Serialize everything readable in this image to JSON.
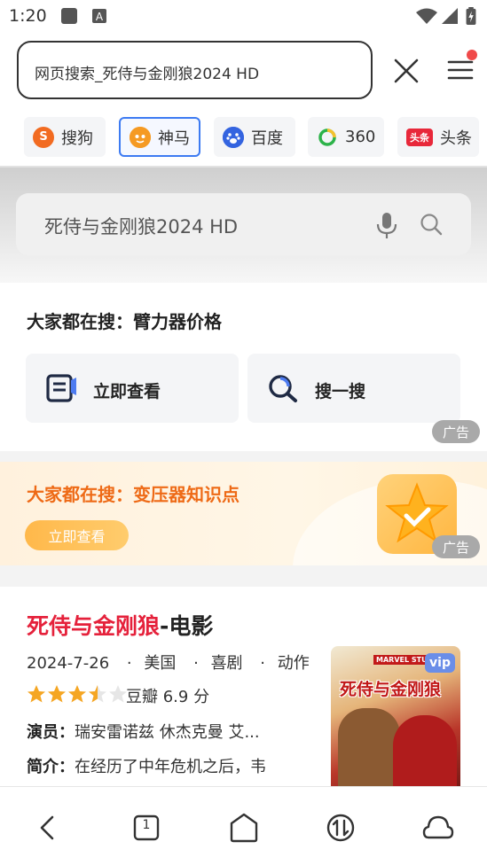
{
  "status_bar": {
    "time": "1:20",
    "icons": [
      "square-app-icon",
      "a-keyboard-icon",
      "wifi-icon",
      "signal-icon",
      "battery-icon"
    ]
  },
  "address_bar": {
    "text": "网页搜索_死侍与金刚狼2024 HD",
    "close_icon": "close-icon",
    "menu_icon": "menu-icon",
    "menu_has_notification": true
  },
  "engines": [
    {
      "label": "搜狗",
      "icon": "sogou-logo",
      "active": false,
      "color": "#f26b21"
    },
    {
      "label": "神马",
      "icon": "shenma-logo",
      "active": true,
      "color": "#f59a23"
    },
    {
      "label": "百度",
      "icon": "baidu-logo",
      "active": false,
      "color": "#3464e0"
    },
    {
      "label": "360",
      "icon": "360-logo",
      "active": false,
      "color": "#2db34a"
    },
    {
      "label": "头条",
      "icon": "toutiao-logo",
      "active": false,
      "color": "#e8283a"
    }
  ],
  "search": {
    "query": "死侍与金刚狼2024 HD",
    "mic_icon": "microphone-icon",
    "search_icon": "search-icon"
  },
  "hot_search": {
    "title": "大家都在搜：臂力器价格",
    "buttons": [
      {
        "label": "立即查看",
        "icon": "document-icon"
      },
      {
        "label": "搜一搜",
        "icon": "magnifier-icon"
      }
    ],
    "ad_label": "广告"
  },
  "banner_ad": {
    "title": "大家都在搜：变压器知识点",
    "button": "立即查看",
    "ad_label": "广告",
    "accent": "#ee6a16"
  },
  "movie": {
    "title_highlight": "死侍与金刚狼",
    "title_rest": "-电影",
    "date": "2024-7-26",
    "region": "美国",
    "genre1": "喜剧",
    "genre2": "动作",
    "sep": "·",
    "stars": 3.5,
    "rating": "豆瓣 6.9 分",
    "cast_key": "演员：",
    "cast_value": "瑞安雷诺兹 休杰克曼 艾...",
    "intro_key": "简介：",
    "intro_value": "在经历了中年危机之后，韦",
    "poster": {
      "vip": "vip",
      "studio": "MARVEL STUDIOS",
      "title": "死侍与金刚狼"
    },
    "highlight_color": "#e5213b"
  },
  "bottom_nav": [
    {
      "icon": "back-icon"
    },
    {
      "icon": "tabs-icon",
      "count": "1"
    },
    {
      "icon": "home-icon"
    },
    {
      "icon": "transfer-icon"
    },
    {
      "icon": "cloud-icon"
    }
  ]
}
